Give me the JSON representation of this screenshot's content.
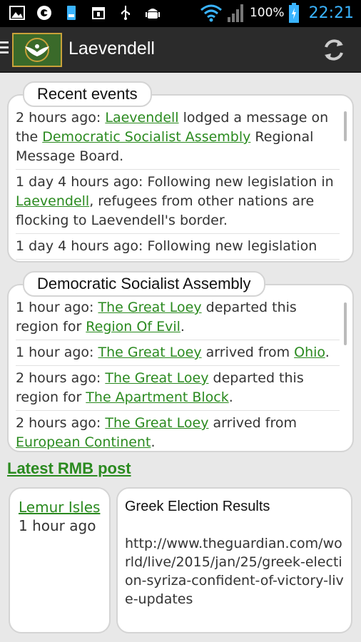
{
  "status_bar": {
    "battery": "100%",
    "time": "22:21",
    "icons": [
      "image-icon",
      "sync-app-icon",
      "storage-icon",
      "calendar-icon",
      "usb-icon",
      "android-debug-icon",
      "wifi-icon",
      "signal-icon",
      "battery-icon"
    ]
  },
  "app_bar": {
    "title": "Laevendell",
    "colors": {
      "accent": "#2a8a1f",
      "flag_green": "#3a6a2a",
      "flag_border": "#c9a23a"
    }
  },
  "recent_events": {
    "label": "Recent events",
    "entries": [
      {
        "pre": "2 hours ago: ",
        "link1": "Laevendell",
        "mid": " lodged a message on the ",
        "link2": "Democratic Socialist Assembly",
        "post": " Regional Message Board."
      },
      {
        "pre": "1 day 4 hours ago: Following new legislation in ",
        "link1": "Laevendell",
        "post": ", refugees from other nations are flocking to Laevendell's border."
      },
      {
        "pre": "1 day 4 hours ago: Following new legislation"
      }
    ]
  },
  "region": {
    "label": "Democratic Socialist Assembly",
    "entries": [
      {
        "pre": "1 hour ago: ",
        "link1": "The Great Loey",
        "mid": " departed this region for ",
        "link2": "Region Of Evil",
        "post": "."
      },
      {
        "pre": "1 hour ago: ",
        "link1": "The Great Loey",
        "mid": " arrived from ",
        "link2": "Ohio",
        "post": "."
      },
      {
        "pre": "2 hours ago: ",
        "link1": "The Great Loey",
        "mid": " departed this region for ",
        "link2": "The Apartment Block",
        "post": "."
      },
      {
        "pre": "2 hours ago: ",
        "link1": "The Great Loey",
        "mid": " arrived from ",
        "link2": "European Continent",
        "post": "."
      }
    ]
  },
  "rmb": {
    "heading": "Latest RMB post",
    "author": "Lemur Isles",
    "time": "1 hour ago",
    "title": "Greek Election Results",
    "body": "http://www.theguardian.com/world/live/2015/jan/25/greek-election-syriza-confident-of-victory-live-updates"
  }
}
